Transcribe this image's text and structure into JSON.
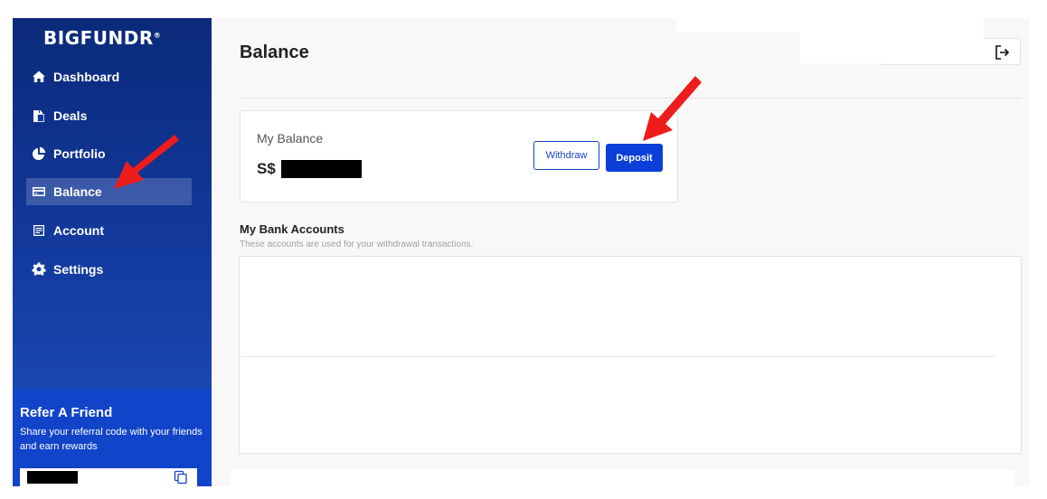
{
  "sidebar": {
    "logo": "BIGFUNDR",
    "logo_mark": "®",
    "items": [
      {
        "label": "Dashboard",
        "icon": "home-icon"
      },
      {
        "label": "Deals",
        "icon": "documents-icon"
      },
      {
        "label": "Portfolio",
        "icon": "pie-chart-icon"
      },
      {
        "label": "Balance",
        "icon": "credit-card-icon",
        "active": true
      },
      {
        "label": "Account",
        "icon": "id-card-icon"
      },
      {
        "label": "Settings",
        "icon": "gear-icon"
      }
    ]
  },
  "refer": {
    "title": "Refer A Friend",
    "description": "Share your referral code with your friends and earn rewards"
  },
  "header": {
    "title": "Balance"
  },
  "balance": {
    "label": "My Balance",
    "currency": "S$",
    "withdraw_label": "Withdraw",
    "deposit_label": "Deposit"
  },
  "bank_accounts": {
    "title": "My Bank Accounts",
    "subtitle": "These accounts are used for your withdrawal transactions."
  },
  "colors": {
    "sidebar_top": "#0b2a7a",
    "sidebar_bottom": "#1f4fc0",
    "accent": "#0a3fd8",
    "annotation_arrow": "#ee1c1c"
  }
}
